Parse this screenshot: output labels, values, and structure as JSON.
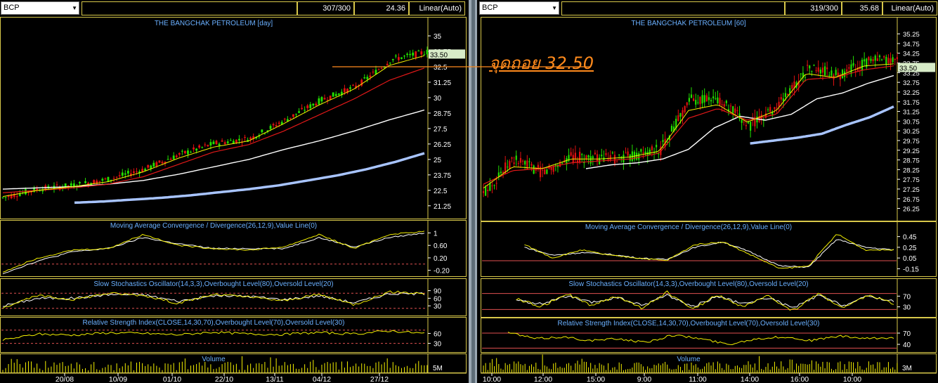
{
  "colors": {
    "background": "#000000",
    "pane_border": "#d8c84a",
    "panel_title": "#6ab0ff",
    "axis_text": "#ffffff",
    "candle_up": "#22e000",
    "candle_down": "#e01010",
    "ma_short": "#f4f000",
    "ma_mid": "#e01818",
    "ma_long": "#ffffff",
    "ma_longest": "#a8c4ff",
    "macd_line": "#f4f000",
    "signal_line": "#ffffff",
    "level_line": "#e05050",
    "price_marker_bg": "#d8ecc8",
    "annotation": "#ff8a1c"
  },
  "annotation": {
    "text": "จุดถอย 32.50",
    "price": 32.5
  },
  "chart_data": [
    {
      "type": "candlestick",
      "pane": "left",
      "symbol": "BCP",
      "counter": "307/300",
      "last_value": "24.36",
      "scale": "Linear(Auto)",
      "title": "THE BANGCHAK PETROLEUM [day]",
      "price_marker": "33.50",
      "ylim": [
        20.5,
        35.4
      ],
      "y_ticks": [
        "35",
        "33.75",
        "32.5",
        "31.25",
        "30",
        "28.75",
        "27.5",
        "26.25",
        "25",
        "23.75",
        "22.5",
        "21.25"
      ],
      "x_ticks": [
        "20/08",
        "10/09",
        "01/10",
        "22/10",
        "13/11",
        "04/12",
        "27/12"
      ],
      "key_points_x": [
        0,
        0.1,
        0.2,
        0.3,
        0.4,
        0.5,
        0.6,
        0.7,
        0.8,
        0.85,
        0.9,
        0.95,
        1.0
      ],
      "close_path": [
        21.9,
        22.6,
        22.9,
        23.4,
        24.2,
        25.4,
        26.3,
        26.7,
        28.2,
        29.8,
        30.9,
        33.1,
        33.7
      ],
      "ma_short_path": [
        22.0,
        22.5,
        22.8,
        23.2,
        24.0,
        25.1,
        26.0,
        26.5,
        27.9,
        29.4,
        30.7,
        32.6,
        33.4
      ],
      "ma_mid_path": [
        22.3,
        22.5,
        22.7,
        23.0,
        23.6,
        24.6,
        25.6,
        26.2,
        27.3,
        28.6,
        29.9,
        31.4,
        32.4
      ],
      "ma_long_path": [
        22.6,
        22.7,
        22.8,
        23.0,
        23.3,
        23.8,
        24.4,
        25.0,
        25.8,
        26.5,
        27.3,
        28.2,
        29.0
      ],
      "ma_longest_path": [
        21.5,
        21.6,
        21.75,
        21.9,
        22.1,
        22.35,
        22.6,
        22.9,
        23.3,
        23.7,
        24.2,
        24.8,
        25.5
      ],
      "ma_longest_start": 0.17,
      "indicators": [
        {
          "name": "Moving Average Convergence / Divergence(26,12,9),Value Line(0)",
          "y_ticks": [
            "1",
            "0.60",
            "0.20",
            "-0.20"
          ],
          "ylim": [
            -0.32,
            1.1
          ],
          "levels": [
            0
          ],
          "line_path": [
            -0.25,
            0.2,
            0.45,
            0.5,
            0.95,
            0.6,
            0.5,
            0.45,
            0.55,
            0.95,
            0.5,
            0.95,
            1.05
          ],
          "signal_path": [
            -0.3,
            0.1,
            0.4,
            0.5,
            0.85,
            0.65,
            0.5,
            0.5,
            0.5,
            0.85,
            0.55,
            0.85,
            1.0
          ]
        },
        {
          "name": "Slow Stochastics Oscillator(14,3,3),Overbought Level(80),Oversold Level(20)",
          "y_ticks": [
            "90",
            "60",
            "30"
          ],
          "ylim": [
            0,
            100
          ],
          "levels": [
            80,
            20
          ],
          "line_path": [
            25,
            70,
            55,
            80,
            72,
            40,
            75,
            65,
            50,
            75,
            35,
            85,
            80
          ],
          "signal_path": [
            30,
            60,
            60,
            75,
            74,
            48,
            70,
            68,
            55,
            70,
            42,
            78,
            78
          ]
        },
        {
          "name": "Relative Strength Index(CLOSE,14,30,70),Overbought Level(70),Oversold Level(30)",
          "y_ticks": [
            "60",
            "30"
          ],
          "ylim": [
            10,
            80
          ],
          "levels": [
            70,
            30
          ],
          "line_path": [
            40,
            58,
            55,
            62,
            60,
            56,
            64,
            58,
            57,
            63,
            58,
            68,
            60
          ]
        },
        {
          "name": "Volume",
          "y_ticks": [
            "5M"
          ],
          "type": "bar"
        }
      ]
    },
    {
      "type": "candlestick",
      "pane": "right",
      "symbol": "BCP",
      "counter": "319/300",
      "last_value": "35.68",
      "scale": "Linear(Auto)",
      "title": "THE BANGCHAK PETROLEUM [60]",
      "price_marker": "33.50",
      "ylim": [
        25.8,
        35.4
      ],
      "y_ticks": [
        "35.25",
        "34.75",
        "34.25",
        "33.75",
        "33.25",
        "32.75",
        "32.25",
        "31.75",
        "31.25",
        "30.75",
        "30.25",
        "29.75",
        "29.25",
        "28.75",
        "28.25",
        "27.75",
        "27.25",
        "26.75",
        "26.25"
      ],
      "x_ticks": [
        "10:00",
        "12:00",
        "15:00",
        "9:00",
        "11:00",
        "14:00",
        "16:00",
        "10:00"
      ],
      "key_points_x": [
        0,
        0.05,
        0.1,
        0.2,
        0.3,
        0.4,
        0.5,
        0.6,
        0.65,
        0.72,
        0.78,
        0.85,
        0.9,
        0.95,
        1.0
      ],
      "close_path": [
        27.0,
        28.8,
        28.1,
        28.9,
        28.8,
        28.9,
        29.3,
        31.9,
        31.8,
        30.5,
        31.6,
        33.5,
        33.1,
        33.8,
        33.9
      ],
      "ma_short_path": [
        27.3,
        28.4,
        28.3,
        28.8,
        28.8,
        28.9,
        29.2,
        31.3,
        31.6,
        30.7,
        31.3,
        33.2,
        33.0,
        33.6,
        33.7
      ],
      "ma_mid_path": [
        27.5,
        28.2,
        28.3,
        28.6,
        28.7,
        28.8,
        29.1,
        30.9,
        31.4,
        30.8,
        31.1,
        32.9,
        33.0,
        33.4,
        33.6
      ],
      "ma_long_start": 0.25,
      "ma_long_path": [
        28.3,
        28.5,
        28.6,
        28.8,
        29.3,
        30.4,
        31.0,
        30.8,
        31.1,
        31.9,
        32.2,
        32.7,
        33.1
      ],
      "ma_longest_start": 0.65,
      "ma_longest_path": [
        29.6,
        29.75,
        29.9,
        30.1,
        30.55,
        30.95,
        31.5
      ],
      "indicators": [
        {
          "name": "Moving Average Convergence / Divergence(26,12,9),Value Line(0)",
          "y_ticks": [
            "0.45",
            "0.25",
            "0.05",
            "-0.15"
          ],
          "ylim": [
            -0.25,
            0.55
          ],
          "levels": [
            0
          ],
          "start": 0.1,
          "line_path": [
            0.3,
            0.05,
            0.2,
            0.1,
            0.05,
            0.0,
            0.3,
            0.35,
            0.1,
            -0.15,
            -0.1,
            0.5,
            0.2,
            0.2
          ],
          "signal_path": [
            0.25,
            0.1,
            0.15,
            0.12,
            0.05,
            0.02,
            0.25,
            0.35,
            0.15,
            -0.1,
            -0.12,
            0.4,
            0.25,
            0.2
          ]
        },
        {
          "name": "Slow Stochastics Oscillator(14,3,3),Overbought Level(80),Oversold Level(20)",
          "y_ticks": [
            "70",
            "30"
          ],
          "ylim": [
            0,
            100
          ],
          "levels": [
            80,
            20
          ],
          "start": 0.08,
          "line_path": [
            60,
            30,
            80,
            35,
            70,
            25,
            85,
            20,
            75,
            30,
            70,
            15,
            80,
            25,
            75,
            40
          ],
          "signal_path": [
            55,
            40,
            70,
            45,
            65,
            35,
            75,
            30,
            70,
            40,
            65,
            25,
            72,
            35,
            70,
            50
          ]
        },
        {
          "name": "Relative Strength Index(CLOSE,14,30,70),Overbought Level(70),Oversold Level(30)",
          "y_ticks": [
            "70",
            "40"
          ],
          "ylim": [
            25,
            85
          ],
          "levels": [
            70,
            30
          ],
          "start": 0.06,
          "line_path": [
            72,
            55,
            60,
            50,
            55,
            45,
            65,
            55,
            40,
            55,
            60,
            50,
            62,
            55,
            58
          ]
        },
        {
          "name": "Volume",
          "y_ticks": [
            "3M"
          ],
          "type": "bar"
        }
      ]
    }
  ]
}
